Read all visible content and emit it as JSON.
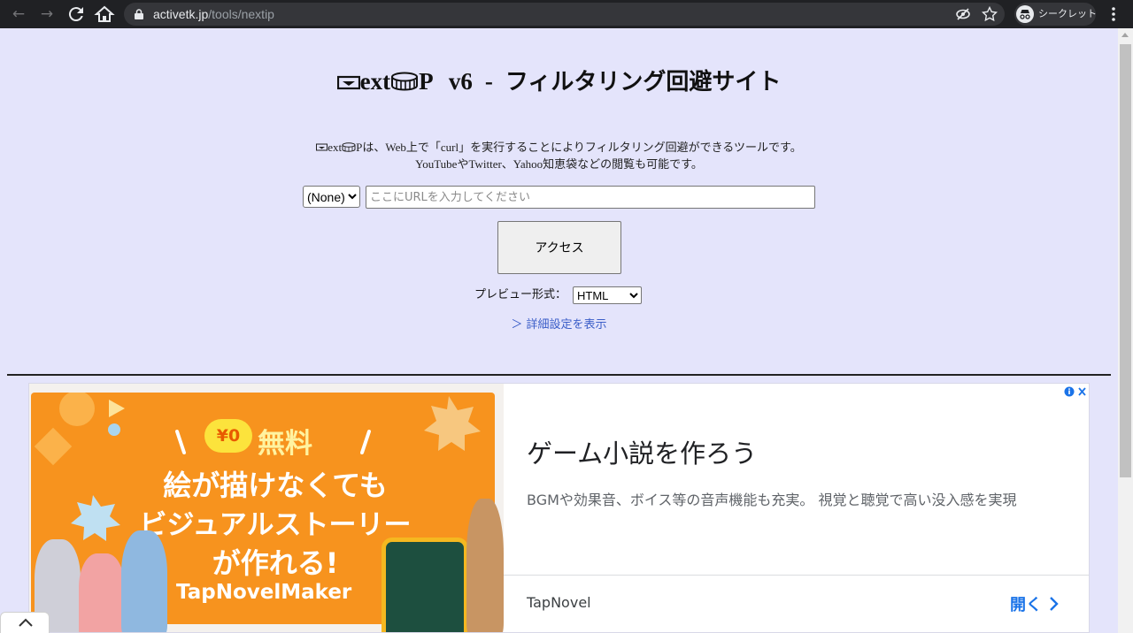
{
  "browser": {
    "url_host": "activetk.jp",
    "url_path": "/tools/nextip",
    "profile_label": "シークレット",
    "icons": [
      "back-arrow-icon",
      "forward-arrow-icon",
      "reload-icon",
      "home-icon",
      "lock-icon",
      "eye-off-icon",
      "star-icon",
      "incognito-icon",
      "kebab-menu-icon"
    ]
  },
  "page": {
    "title_logo": "ext",
    "title_logo_end": "P",
    "title_version": "v6",
    "title_separator": "-",
    "title_subtitle": "フィルタリング回避サイト",
    "desc_logo": "ext",
    "desc_logo_end": "P",
    "desc_line1_rest": "は、Web上で「curl」を実行することによりフィルタリング回避ができるツールです。",
    "desc_line2": "YouTubeやTwitter、Yahoo知恵袋などの閲覧も可能です。",
    "proxy_option": "(None)",
    "url_placeholder": "ここにURLを入力してください",
    "access_button": "アクセス",
    "preview_label": "プレビュー形式：",
    "preview_option": "HTML",
    "detail_link": "＞ 詳細設定を表示"
  },
  "ad": {
    "badge": "¥0",
    "free_label": "無料",
    "headline1": "絵が描けなくても",
    "headline2": "ビジュアルストーリー",
    "headline3": "が作れる!",
    "logo_text": "TapNovelMaker",
    "title": "ゲーム小説を作ろう",
    "body": "BGMや効果音、ボイス等の音声機能も充実。 視覚と聴覚で高い没入感を実現",
    "brand": "TapNovel",
    "open_label": "開く",
    "colors": {
      "panel": "#f7931e",
      "open": "#1a73e8",
      "page_bg": "#e4e4fb"
    }
  }
}
